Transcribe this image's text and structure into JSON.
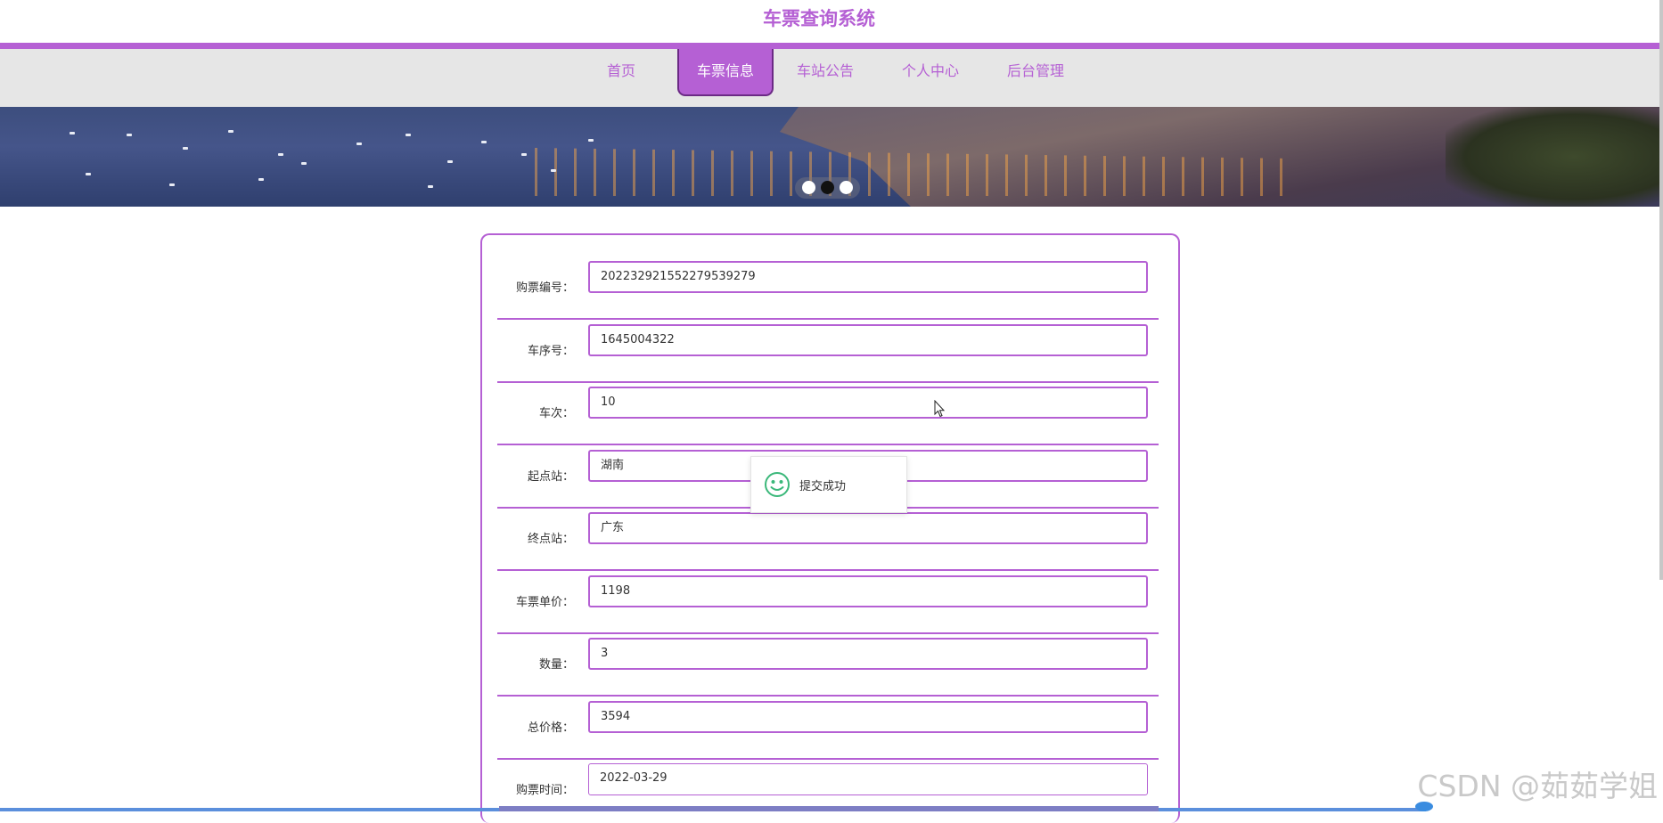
{
  "site": {
    "title": "车票查询系统"
  },
  "nav": {
    "items": [
      {
        "label": "首页"
      },
      {
        "label": "车票信息"
      },
      {
        "label": "车站公告"
      },
      {
        "label": "个人中心"
      },
      {
        "label": "后台管理"
      }
    ],
    "active": "车票信息"
  },
  "carousel": {
    "slide_count": 3,
    "active_index": 1
  },
  "form": {
    "fields": [
      {
        "label": "购票编号：",
        "value": "202232921552279539279"
      },
      {
        "label": "车序号：",
        "value": "1645004322"
      },
      {
        "label": "车次：",
        "value": "10"
      },
      {
        "label": "起点站：",
        "value": "湖南"
      },
      {
        "label": "终点站：",
        "value": "广东"
      },
      {
        "label": "车票单价：",
        "value": "1198"
      },
      {
        "label": "数量：",
        "value": "3"
      },
      {
        "label": "总价格：",
        "value": "3594"
      },
      {
        "label": "购票时间：",
        "value": "2022-03-29"
      }
    ]
  },
  "toast": {
    "message": "提交成功",
    "icon": "smile-icon"
  },
  "watermark": "CSDN @茹茹学姐",
  "colors": {
    "accent": "#b560d4",
    "nav_bg": "#e6e6e6",
    "success": "#3bb87a"
  }
}
